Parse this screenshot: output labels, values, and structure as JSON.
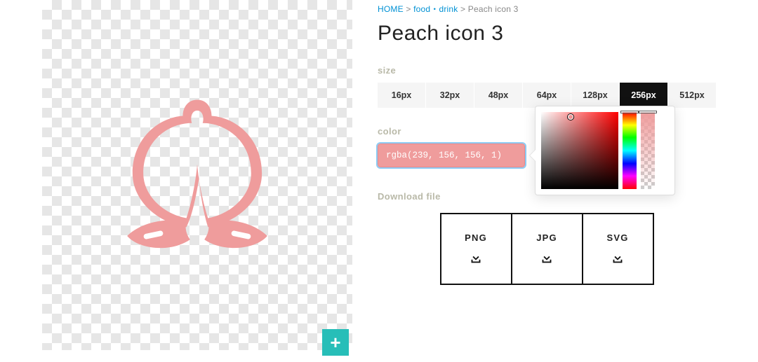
{
  "breadcrumb": {
    "home": "HOME",
    "sep1": " > ",
    "cat": "food・drink",
    "sep2": " > ",
    "current": "Peach icon 3"
  },
  "title": "Peach icon 3",
  "labels": {
    "size": "size",
    "color": "color",
    "download": "Download file"
  },
  "sizes": [
    "16px",
    "32px",
    "48px",
    "64px",
    "128px",
    "256px",
    "512px"
  ],
  "size_active_index": 5,
  "color_value": "rgba(239, 156, 156, 1)",
  "icon_color": "#ef9c9c",
  "downloads": [
    "PNG",
    "JPG",
    "SVG"
  ],
  "add_button_symbol": "+"
}
